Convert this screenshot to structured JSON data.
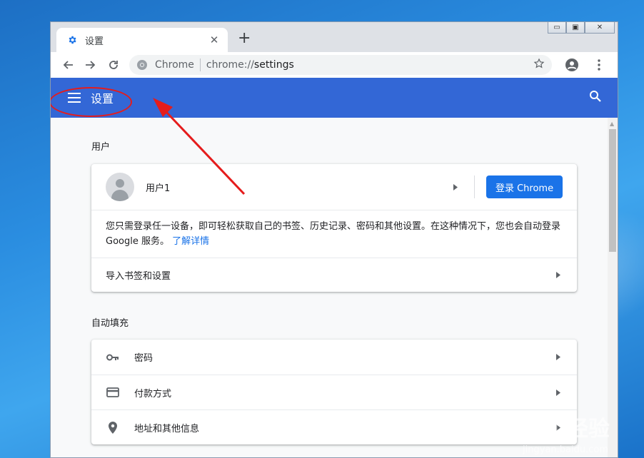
{
  "browser": {
    "tab_title": "设置",
    "omnibox_site": "Chrome",
    "url_scheme": "chrome://",
    "url_path": "settings"
  },
  "header": {
    "title": "设置"
  },
  "people": {
    "section_label": "用户",
    "user_name": "用户1",
    "signin_button": "登录 Chrome",
    "description": "您只需登录任一设备，即可轻松获取自己的书签、历史记录、密码和其他设置。在这种情况下，您也会自动登录 Google 服务。",
    "learn_more": "了解详情",
    "import_label": "导入书签和设置"
  },
  "autofill": {
    "section_label": "自动填充",
    "items": [
      {
        "label": "密码",
        "icon": "key-icon"
      },
      {
        "label": "付款方式",
        "icon": "credit-card-icon"
      },
      {
        "label": "地址和其他信息",
        "icon": "location-pin-icon"
      }
    ]
  },
  "watermark": {
    "text": "Baidu经验",
    "sub": "jingyan.baidu.com"
  },
  "colors": {
    "header_blue": "#3367d6",
    "button_blue": "#1a73e8",
    "annotation_red": "#e51c1c"
  }
}
